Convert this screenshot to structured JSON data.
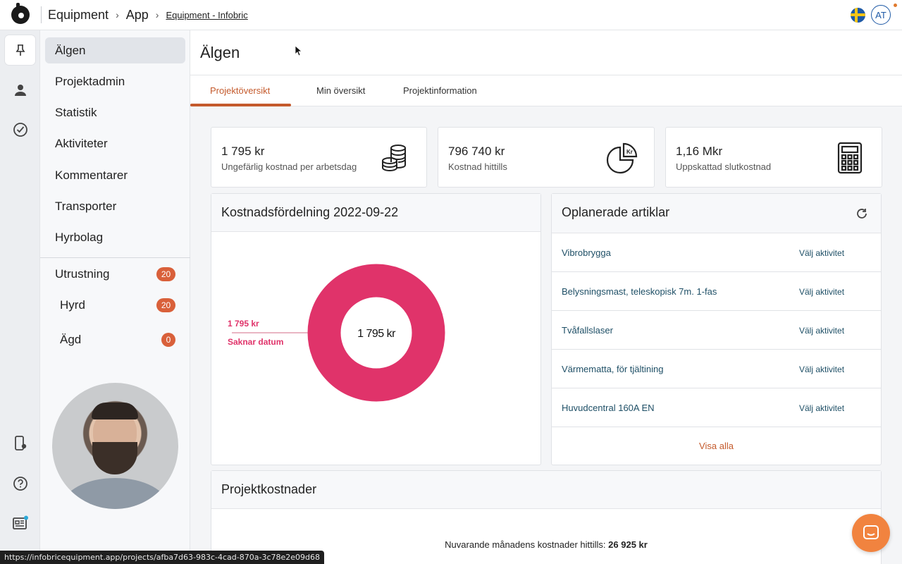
{
  "header": {
    "breadcrumb": [
      "Equipment",
      "App"
    ],
    "breadcrumb_link": "Equipment - Infobric",
    "language_flag": "sweden-flag",
    "user_initials": "AT"
  },
  "rail": {
    "icons": [
      "pin-icon",
      "user-icon",
      "check-circle-icon",
      "phone-location-icon",
      "help-icon",
      "news-icon"
    ]
  },
  "sidebar": {
    "items": [
      {
        "label": "Älgen"
      },
      {
        "label": "Projektadmin"
      },
      {
        "label": "Statistik"
      },
      {
        "label": "Aktiviteter"
      },
      {
        "label": "Kommentarer"
      },
      {
        "label": "Transporter"
      },
      {
        "label": "Hyrbolag"
      }
    ],
    "equipment": [
      {
        "label": "Utrustning",
        "count": "20"
      },
      {
        "label": "Hyrd",
        "count": "20"
      },
      {
        "label": "Ägd",
        "count": "0"
      }
    ]
  },
  "page": {
    "title": "Älgen",
    "tabs": [
      {
        "label": "Projektöversikt"
      },
      {
        "label": "Min översikt"
      },
      {
        "label": "Projektinformation"
      }
    ]
  },
  "stats": [
    {
      "value": "1 795 kr",
      "label": "Ungefärlig kostnad per arbetsdag",
      "icon": "coins-icon"
    },
    {
      "value": "796 740 kr",
      "label": "Kostnad hittills",
      "icon": "pie-kr-icon"
    },
    {
      "value": "1,16 Mkr",
      "label": "Uppskattad slutkostnad",
      "icon": "calculator-icon"
    }
  ],
  "cost_distribution": {
    "title": "Kostnadsfördelning 2022-09-22",
    "center_label": "1 795 kr",
    "callout_value": "1 795 kr",
    "callout_label": "Saknar datum",
    "color": "#e0336a"
  },
  "unplanned": {
    "title": "Oplanerade artiklar",
    "items": [
      {
        "name": "Vibrobrygga",
        "action": "Välj aktivitet"
      },
      {
        "name": "Belysningsmast, teleskopisk 7m. 1-fas",
        "action": "Välj aktivitet"
      },
      {
        "name": "Tvåfallslaser",
        "action": "Välj aktivitet"
      },
      {
        "name": "Värmematta, för tjältining",
        "action": "Välj aktivitet"
      },
      {
        "name": "Huvudcentral 160A EN",
        "action": "Välj aktivitet"
      }
    ],
    "show_all": "Visa alla"
  },
  "project_costs": {
    "title": "Projektkostnader",
    "month_label": "Nuvarande månadens kostnader hittills:",
    "month_value": "26 925 kr"
  },
  "status_url": "https://infobricequipment.app/projects/afba7d63-983c-4cad-870a-3c78e2e09d68",
  "colors": {
    "accent": "#c45a2c",
    "badge": "#d9603a",
    "chat": "#f1833f"
  }
}
